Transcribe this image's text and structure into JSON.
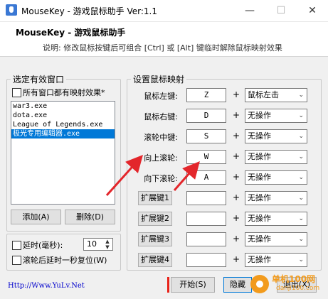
{
  "titlebar": {
    "title": "MouseKey - 游戏鼠标助手 Ver:1.1",
    "minimize": "—",
    "maximize": "☐",
    "close": "✕"
  },
  "header": {
    "title": "MouseKey - 游戏鼠标助手",
    "desc": "说明: 修改鼠标按键后可组合 [Ctrl] 或 [Alt] 键临时解除鼠标映射效果"
  },
  "left": {
    "legend": "选定有效窗口",
    "all_windows_label": "所有窗口都有映射效果*",
    "windows": [
      "war3.exe",
      "dota.exe",
      "League of Legends.exe",
      "极光专用编辑器.exe"
    ],
    "selected_index": 3,
    "add_label": "添加(A)",
    "delete_label": "删除(D)"
  },
  "options": {
    "delay_label": "延时(毫秒):",
    "delay_value": "10",
    "wheel_label": "滚轮后延时一秒复位(W)"
  },
  "mapping": {
    "legend": "设置鼠标映射",
    "rows": [
      {
        "label": "鼠标左键:",
        "key": "Z",
        "action": "鼠标左击"
      },
      {
        "label": "鼠标右键:",
        "key": "D",
        "action": "无操作"
      },
      {
        "label": "滚轮中键:",
        "key": "S",
        "action": "无操作"
      },
      {
        "label": "向上滚轮:",
        "key": "W",
        "action": "无操作"
      },
      {
        "label": "向下滚轮:",
        "key": "A",
        "action": "无操作"
      }
    ],
    "ext_rows": [
      {
        "label": "扩展键1",
        "key": "",
        "action": "无操作"
      },
      {
        "label": "扩展键2",
        "key": "",
        "action": "无操作"
      },
      {
        "label": "扩展键3",
        "key": "",
        "action": "无操作"
      },
      {
        "label": "扩展键4",
        "key": "",
        "action": "无操作"
      }
    ],
    "plus": "+"
  },
  "footer": {
    "website": "Http://Www.YuLv.Net",
    "start_label": "开始(S)",
    "hide_label": "隐藏",
    "exit_label": "退出(X)"
  },
  "watermark": {
    "title": "单机100网",
    "url": "danji100.com"
  },
  "colors": {
    "selection": "#0078d7",
    "arrow": "#e3262b",
    "watermark": "#f29b1d"
  }
}
